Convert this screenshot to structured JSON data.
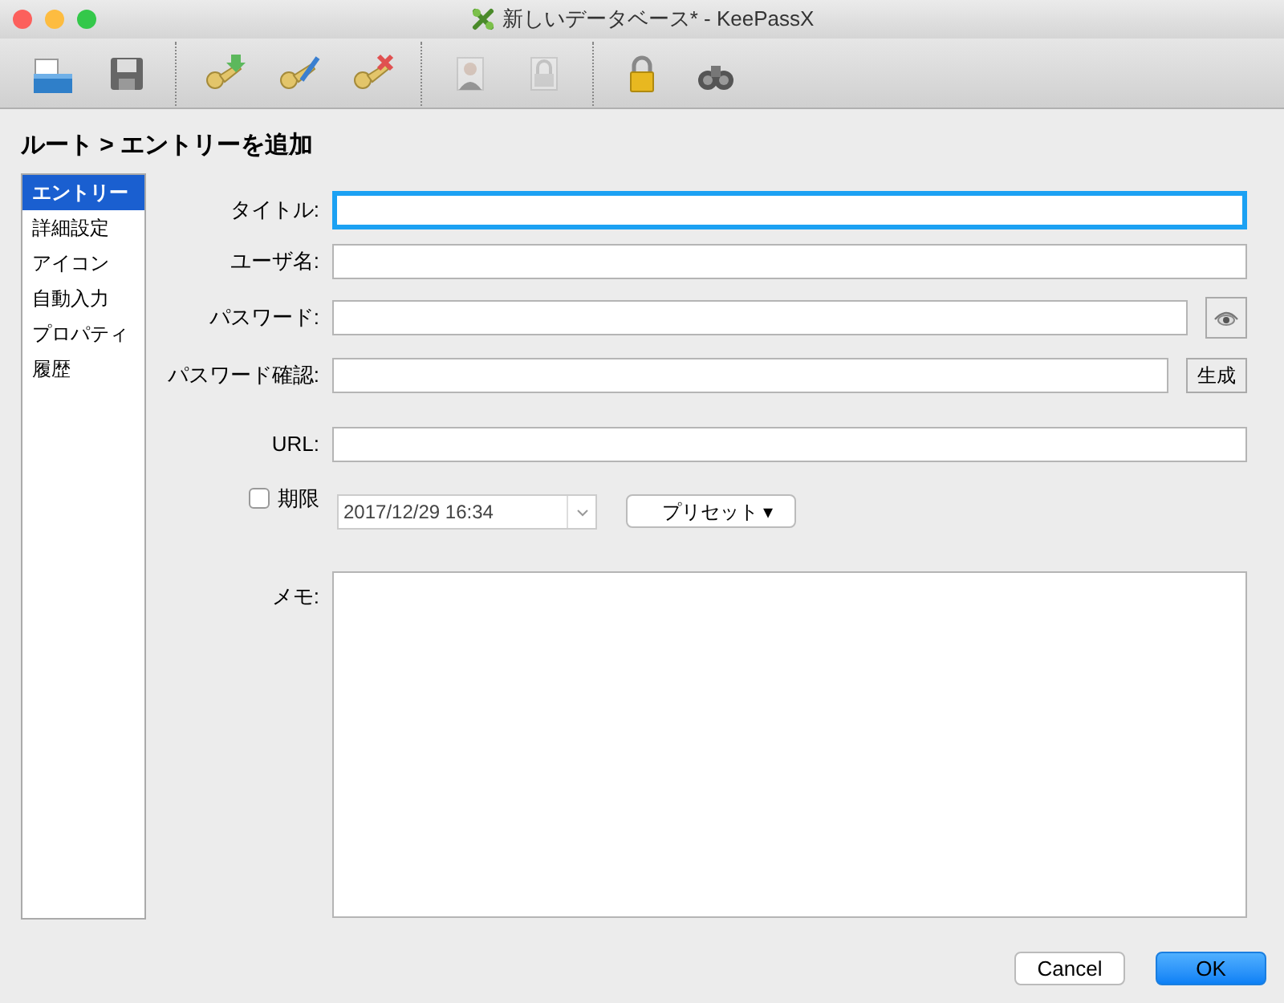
{
  "window": {
    "title": "新しいデータベース* - KeePassX"
  },
  "toolbar": [
    {
      "kind": "open",
      "disabled": false
    },
    {
      "kind": "save",
      "disabled": false
    },
    {
      "kind": "sep"
    },
    {
      "kind": "key-add",
      "disabled": false
    },
    {
      "kind": "key-edit",
      "disabled": false
    },
    {
      "kind": "key-delete",
      "disabled": false
    },
    {
      "kind": "sep"
    },
    {
      "kind": "copy-user",
      "disabled": true
    },
    {
      "kind": "copy-password",
      "disabled": true
    },
    {
      "kind": "sep"
    },
    {
      "kind": "lock",
      "disabled": false
    },
    {
      "kind": "search",
      "disabled": false
    }
  ],
  "breadcrumb": "ルート > エントリーを追加",
  "sidebar": {
    "items": [
      {
        "label": "エントリー",
        "selected": true
      },
      {
        "label": "詳細設定",
        "selected": false
      },
      {
        "label": "アイコン",
        "selected": false
      },
      {
        "label": "自動入力",
        "selected": false
      },
      {
        "label": "プロパティ",
        "selected": false
      },
      {
        "label": "履歴",
        "selected": false
      }
    ]
  },
  "form": {
    "rows": [
      {
        "label": "タイトル:",
        "kind": "text",
        "focused": true
      },
      {
        "label": "ユーザ名:",
        "kind": "text",
        "focused": false
      },
      {
        "label": "パスワード:",
        "kind": "password",
        "focused": false
      },
      {
        "label": "パスワード確認:",
        "kind": "confirm",
        "focused": false,
        "button": "生成"
      },
      {
        "label": "URL:",
        "kind": "url",
        "focused": false
      }
    ],
    "expiry": {
      "label": "期限",
      "checked": false,
      "value": "2017/12/29 16:34",
      "preset": "プリセット ▾"
    },
    "notes": {
      "label": "メモ:"
    }
  },
  "buttons": [
    {
      "label": "Cancel",
      "default": false
    },
    {
      "label": "OK",
      "default": true
    }
  ]
}
